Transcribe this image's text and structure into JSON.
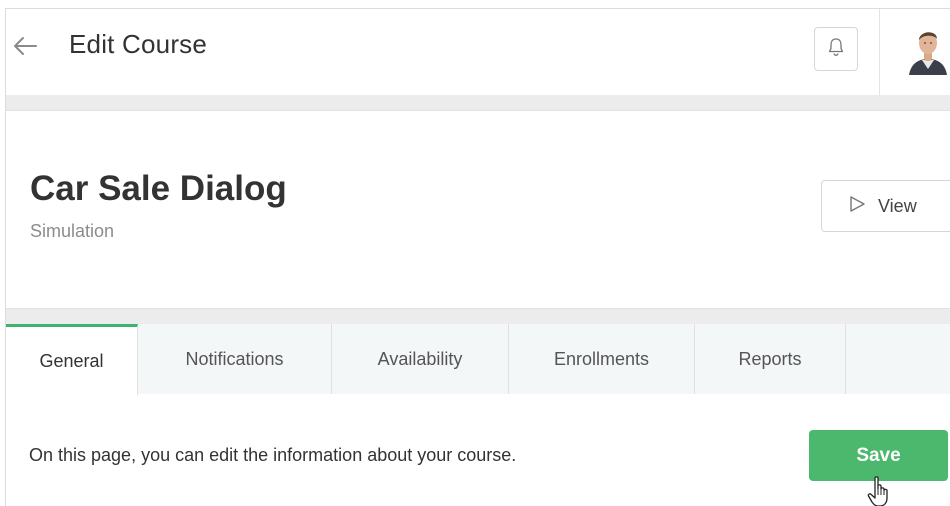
{
  "header": {
    "title": "Edit Course",
    "back_icon": "arrow-left-icon",
    "notification_icon": "bell-icon"
  },
  "course": {
    "name": "Car Sale Dialog",
    "type": "Simulation",
    "view_label": "View",
    "view_icon": "play-outline-icon"
  },
  "tabs": [
    {
      "label": "General",
      "active": true
    },
    {
      "label": "Notifications",
      "active": false
    },
    {
      "label": "Availability",
      "active": false
    },
    {
      "label": "Enrollments",
      "active": false
    },
    {
      "label": "Reports",
      "active": false
    }
  ],
  "general": {
    "description": "On this page, you can edit the information about your course.",
    "save_label": "Save"
  },
  "colors": {
    "accent": "#3cb371",
    "save_button": "#4cb86e",
    "tab_inactive_bg": "#f4f7f8"
  }
}
